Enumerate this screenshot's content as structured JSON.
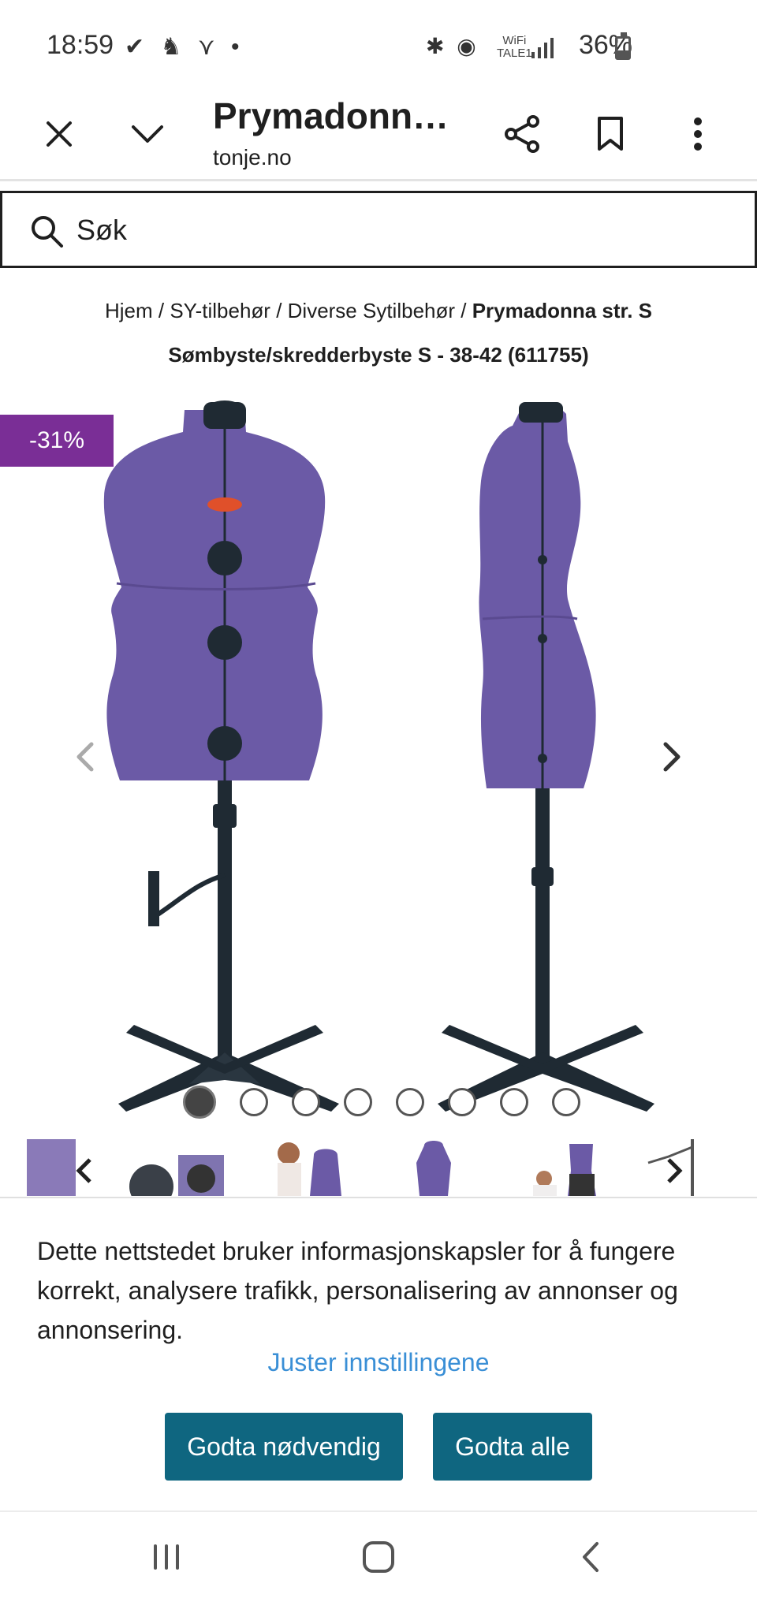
{
  "status_bar": {
    "time": "18:59",
    "notification_icons": "✔ ♞ ⋎ •",
    "system_icons": "✱ ◉",
    "wifi_label_line1": "WiFi",
    "wifi_label_line2": "TALE1",
    "battery": "36%"
  },
  "toolbar": {
    "title": "Prymadonn…",
    "url": "tonje.no",
    "icons": [
      "close-icon",
      "chevron-down-icon",
      "share-icon",
      "bookmark-icon",
      "more-vert-icon"
    ]
  },
  "search": {
    "placeholder": "Søk"
  },
  "breadcrumb": {
    "items": [
      "Hjem",
      "SY-tilbehør",
      "Diverse Sytilbehør"
    ],
    "separator": " / ",
    "current": "Prymadonna str. S Sømbyste/skredderbyste S - 38-42 (611755)"
  },
  "product": {
    "discount_badge": "-31%",
    "body_color": "#6b5aa6",
    "stand_color": "#1f2a33",
    "carousel_dots": 8,
    "active_dot": 0
  },
  "cookie_banner": {
    "text": "Dette nettstedet bruker informasjonskapsler for å fungere korrekt, analysere trafikk, personalisering av annonser og annonsering.",
    "settings_link": "Juster innstillingene",
    "accept_necessary": "Godta nødvendig",
    "accept_all": "Godta alle",
    "accent": "#0f6680",
    "link_color": "#3a8fd6"
  },
  "nav_bar": {
    "icons": [
      "recent-apps-icon",
      "home-icon",
      "back-icon"
    ]
  }
}
